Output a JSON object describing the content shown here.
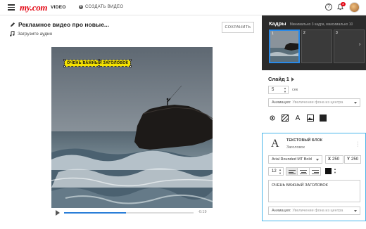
{
  "header": {
    "logo": "my.com",
    "logo_suffix": "VIDEO",
    "create_video": "СОЗДАТЬ ВИДЕО",
    "help_label": "?",
    "notifications_count": "2"
  },
  "editor": {
    "title": "Рекламное видео про новые...",
    "upload_audio": "Загрузите аудио",
    "save_button": "СОХРАНИТЬ",
    "headline": "ОЧЕНЬ ВАЖНЫЙ ЗАГОЛОВОК",
    "time": "-0:19",
    "progress": 0.48
  },
  "frames": {
    "title": "Кадры",
    "subtitle": "Минимально 3 кадра, максимально 10",
    "items": [
      {
        "number": "1",
        "active": true
      },
      {
        "number": "2",
        "active": false
      },
      {
        "number": "3",
        "active": false
      }
    ]
  },
  "slide": {
    "title": "Слайд 1",
    "duration": "5",
    "duration_unit": "сек",
    "animation_label": "Анимация:",
    "animation_value": "Увеличение фона из центра",
    "tools": [
      "target-icon",
      "pattern-icon",
      "text-tool-icon",
      "image-icon",
      "color-square-icon"
    ]
  },
  "text_block": {
    "title": "ТЕКСТОВЫЙ БЛОК",
    "subtitle": "Заголовок",
    "font": "Arial Rounded MT Bold",
    "x_label": "X",
    "x_value": "250",
    "y_label": "Y",
    "y_value": "250",
    "size": "12",
    "text": "ОЧЕНЬ ВАЖНЫЙ ЗАГОЛОВОК",
    "animation_label": "Анимация:",
    "animation_value": "Увеличение фона из центра"
  },
  "colors": {
    "brand": "#e30613",
    "accent": "#2a8ae8",
    "headline_bg": "#f5e200",
    "frames_bg": "#2b2b2b"
  }
}
